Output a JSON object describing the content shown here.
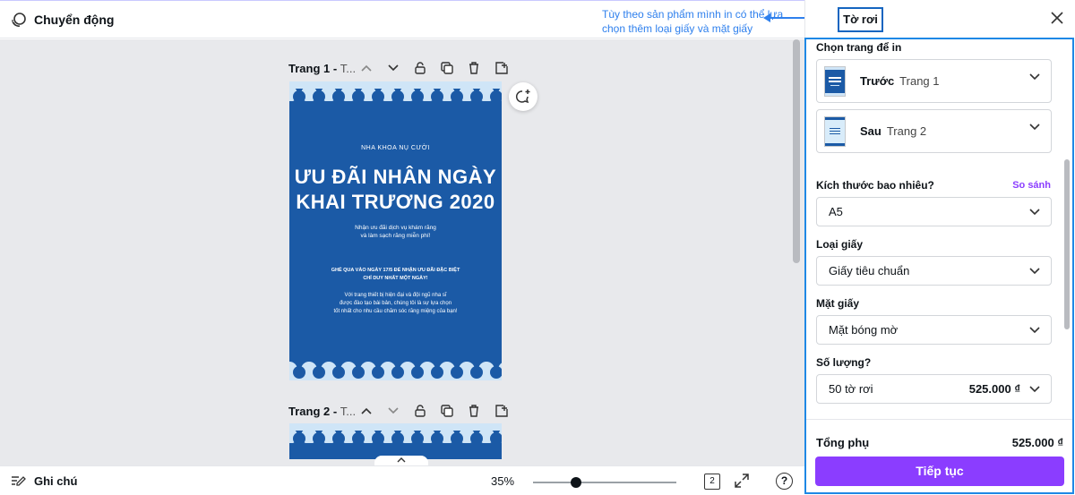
{
  "topbar": {
    "motion_label": "Chuyển động"
  },
  "annotation": {
    "text": "Tùy theo sản phẩm mình in có thể lựa chọn thêm loại giấy và mặt giấy"
  },
  "pages": [
    {
      "title": "Trang 1 - ",
      "title_light": "T..."
    },
    {
      "title": "Trang 2 - ",
      "title_light": "T..."
    }
  ],
  "flyer": {
    "clinic": "NHA KHOA NỤ CƯỜI",
    "headline_1": "ƯU ĐÃI NHÂN NGÀY",
    "headline_2": "KHAI TRƯƠNG 2020",
    "offer_1": "Nhận ưu đãi dịch vụ khám răng",
    "offer_2": "và làm sạch răng miễn phí!",
    "cta_1": "GHÉ QUA VÀO NGÀY 17/5 ĐỂ NHẬN ƯU ĐÃI ĐẶC BIỆT",
    "cta_2": "CHỈ DUY NHẤT MỘT NGÀY!",
    "body_1": "Với trang thiết bị hiện đại và đội ngũ nha sĩ",
    "body_2": "được đào tạo bài bản, chúng tôi là sự lựa chọn",
    "body_3": "tốt nhất cho nhu cầu chăm sóc răng miệng của bạn!"
  },
  "bottombar": {
    "notes_label": "Ghi chú",
    "zoom": "35%",
    "zoom_level": 0.3,
    "page_count": "2",
    "help": "?"
  },
  "panel": {
    "title": "Tờ rơi",
    "print_pages_label": "Chọn trang để in",
    "front": {
      "label": "Trước",
      "page": "Trang 1"
    },
    "back": {
      "label": "Sau",
      "page": "Trang 2"
    },
    "size_label": "Kích thước bao nhiêu?",
    "compare_label": "So sánh",
    "size_value": "A5",
    "paper_type_label": "Loại giấy",
    "paper_type_value": "Giấy tiêu chuẩn",
    "finish_label": "Mặt giấy",
    "finish_value": "Mặt bóng mờ",
    "quantity_label": "Số lượng?",
    "quantity_value": "50 tờ rơi",
    "quantity_price": "525.000 ₫",
    "subtotal_label": "Tổng phụ",
    "subtotal_value": "525.000 ₫",
    "continue_label": "Tiếp tục"
  },
  "colors": {
    "accent": "#8b3dff",
    "flyer_blue": "#1b5aa6",
    "annotation_blue": "#2f80ed"
  }
}
